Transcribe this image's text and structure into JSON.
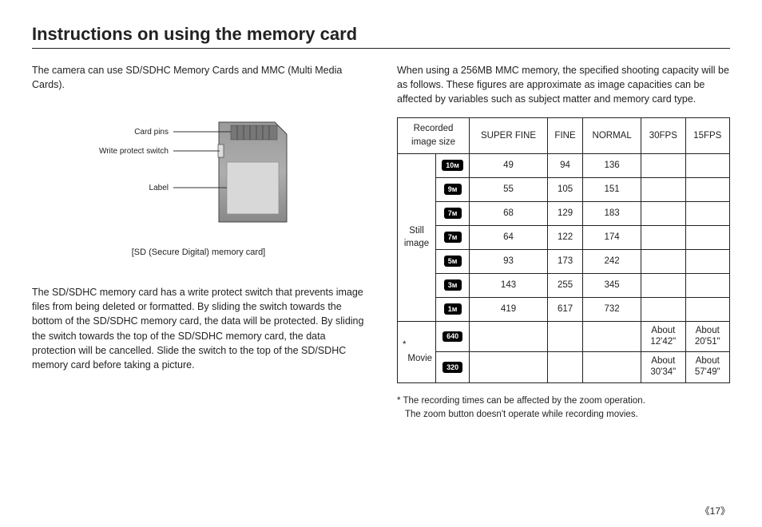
{
  "title": "Instructions on using the memory card",
  "left": {
    "p1": "The camera can use SD/SDHC Memory Cards and MMC (Multi Media Cards).",
    "diag_labels": {
      "pins": "Card pins",
      "switch": "Write protect switch",
      "label": "Label"
    },
    "caption": "[SD (Secure Digital) memory card]",
    "p2": "The SD/SDHC memory card has a write protect switch that prevents image files from being deleted or formatted. By sliding the switch towards the bottom of the SD/SDHC memory card, the data will be protected. By sliding the switch towards the top of the SD/SDHC memory card, the data protection will be cancelled. Slide the switch to the top of the SD/SDHC memory card before taking a picture."
  },
  "right": {
    "intro": "When using a 256MB MMC memory, the specified shooting capacity will be as follows. These figures are approximate as image capacities can be affected by variables such as subject matter and memory card type.",
    "headers": {
      "size": "Recorded image size",
      "sf": "SUPER FINE",
      "fine": "FINE",
      "normal": "NORMAL",
      "fps30": "30FPS",
      "fps15": "15FPS"
    },
    "groups": {
      "still": "Still image",
      "movie": "* Movie"
    },
    "still_rows": [
      {
        "badge": "10м",
        "sf": "49",
        "fine": "94",
        "normal": "136"
      },
      {
        "badge": "9м",
        "sf": "55",
        "fine": "105",
        "normal": "151"
      },
      {
        "badge": "7м",
        "sf": "68",
        "fine": "129",
        "normal": "183"
      },
      {
        "badge": "7м",
        "sf": "64",
        "fine": "122",
        "normal": "174"
      },
      {
        "badge": "5м",
        "sf": "93",
        "fine": "173",
        "normal": "242"
      },
      {
        "badge": "3м",
        "sf": "143",
        "fine": "255",
        "normal": "345"
      },
      {
        "badge": "1м",
        "sf": "419",
        "fine": "617",
        "normal": "732"
      }
    ],
    "movie_rows": [
      {
        "badge": "640",
        "fps30": "About 12'42\"",
        "fps15": "About 20'51\""
      },
      {
        "badge": "320",
        "fps30": "About 30'34\"",
        "fps15": "About 57'49\""
      }
    ],
    "footnote1": "* The recording times can be affected by the zoom operation.",
    "footnote2": "The zoom button doesn't operate while recording movies."
  },
  "pagenum": "《17》"
}
